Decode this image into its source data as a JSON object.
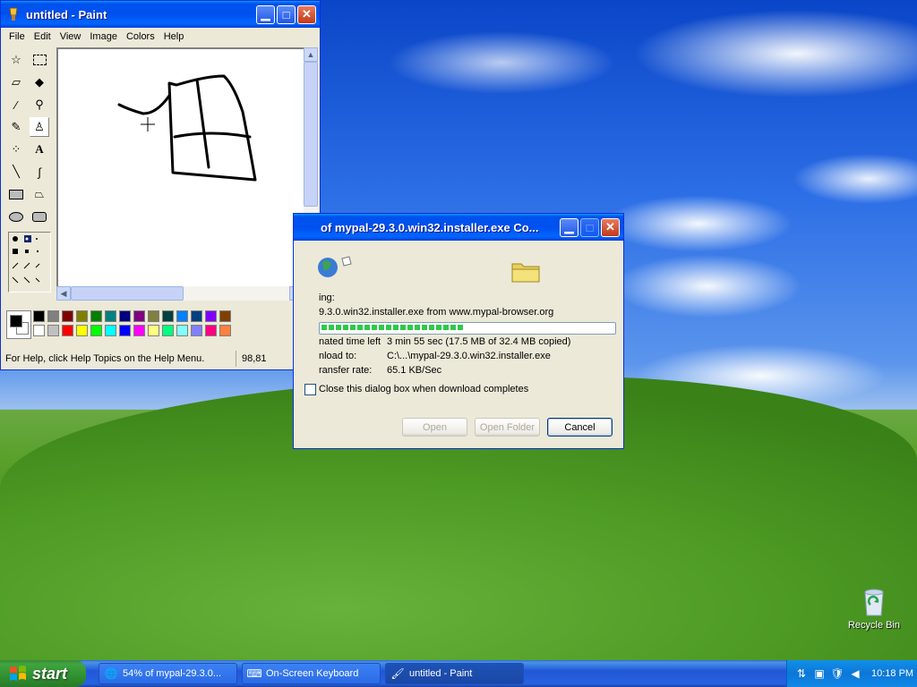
{
  "paint": {
    "title": "untitled - Paint",
    "menu": [
      "File",
      "Edit",
      "View",
      "Image",
      "Colors",
      "Help"
    ],
    "status_help": "For Help, click Help Topics on the Help Menu.",
    "status_coords": "98,81",
    "tools": [
      "free-form-select-icon",
      "select-icon",
      "eraser-icon",
      "fill-icon",
      "pick-color-icon",
      "magnifier-icon",
      "pencil-icon",
      "brush-icon",
      "airbrush-icon",
      "text-icon",
      "line-icon",
      "curve-icon",
      "rectangle-icon",
      "polygon-icon",
      "ellipse-icon",
      "rounded-rect-icon"
    ],
    "palette_top": [
      "#000000",
      "#808080",
      "#800000",
      "#808000",
      "#008000",
      "#008080",
      "#000080",
      "#800080",
      "#808040",
      "#004040",
      "#0080ff",
      "#004080",
      "#8000ff",
      "#804000"
    ],
    "palette_bottom": [
      "#ffffff",
      "#c0c0c0",
      "#ff0000",
      "#ffff00",
      "#00ff00",
      "#00ffff",
      "#0000ff",
      "#ff00ff",
      "#ffff80",
      "#00ff80",
      "#80ffff",
      "#8080ff",
      "#ff0080",
      "#ff8040"
    ],
    "foreground": "#000000",
    "background": "#ffffff"
  },
  "download": {
    "title": "of mypal-29.3.0.win32.installer.exe Co...",
    "saving_label": "ing:",
    "file_line": "9.3.0.win32.installer.exe from www.mypal-browser.org",
    "progress": 0.54,
    "time_left_label": "nated time left",
    "time_left_value": "3 min 55 sec (17.5 MB of 32.4 MB copied)",
    "download_to_label": "nload to:",
    "download_to_value": "C:\\...\\mypal-29.3.0.win32.installer.exe",
    "rate_label": "ransfer rate:",
    "rate_value": "65.1 KB/Sec",
    "close_checkbox_label": "Close this dialog box when download completes",
    "open_label": "Open",
    "open_folder_label": "Open Folder",
    "cancel_label": "Cancel"
  },
  "desktop": {
    "recycle_bin_label": "Recycle Bin"
  },
  "taskbar": {
    "start_label": "start",
    "tasks": [
      {
        "label": "54% of mypal-29.3.0...",
        "icon": "download-icon"
      },
      {
        "label": "On-Screen Keyboard",
        "icon": "keyboard-icon"
      },
      {
        "label": "untitled - Paint",
        "icon": "paint-icon"
      }
    ],
    "clock": "10:18 PM"
  }
}
